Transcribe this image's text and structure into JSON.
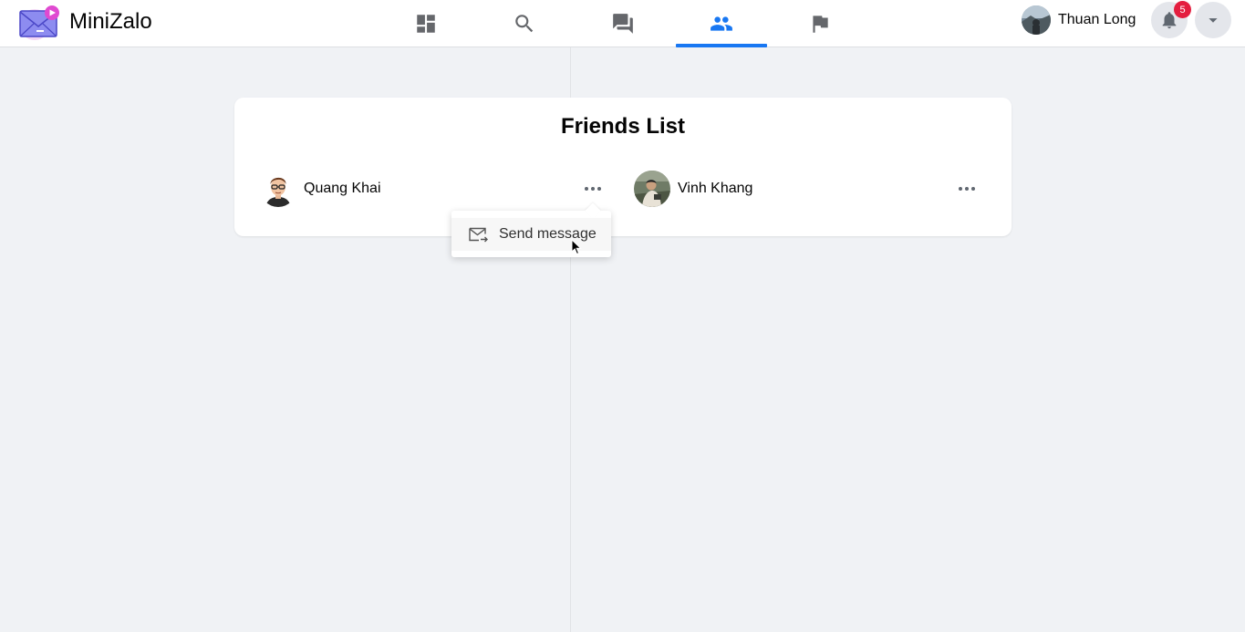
{
  "app": {
    "name": "MiniZalo"
  },
  "nav": {
    "tabs": [
      {
        "icon": "dashboard-icon",
        "active": false
      },
      {
        "icon": "search-icon",
        "active": false
      },
      {
        "icon": "messages-icon",
        "active": false
      },
      {
        "icon": "friends-icon",
        "active": true
      },
      {
        "icon": "flag-icon",
        "active": false
      }
    ]
  },
  "user": {
    "name": "Thuan Long",
    "notification_count": "5"
  },
  "friends_list": {
    "title": "Friends List",
    "friends": [
      {
        "name": "Quang Khai"
      },
      {
        "name": "Vinh Khang"
      }
    ]
  },
  "menu": {
    "send_message_label": "Send message"
  },
  "colors": {
    "accent": "#1877f2",
    "badge": "#e41e3f",
    "background": "#f0f2f5"
  }
}
